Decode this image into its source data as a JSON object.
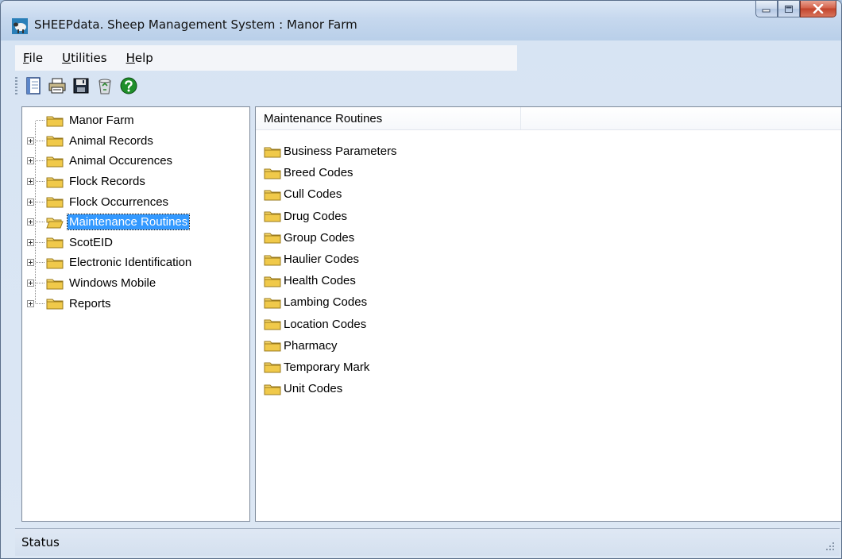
{
  "window": {
    "title": "SHEEPdata. Sheep Management System : Manor Farm",
    "caption_buttons": [
      "minimize",
      "maximize",
      "close"
    ]
  },
  "menu": [
    {
      "label": "File",
      "accel": "F",
      "rest": "ile"
    },
    {
      "label": "Utilities",
      "accel": "U",
      "rest": "tilities"
    },
    {
      "label": "Help",
      "accel": "H",
      "rest": "elp"
    }
  ],
  "toolbar": {
    "icons": [
      "new-document-icon",
      "print-icon",
      "save-icon",
      "recycle-bin-icon",
      "help-icon"
    ]
  },
  "tree": {
    "root": "Manor Farm",
    "items": [
      {
        "label": "Animal Records",
        "expandable": true,
        "selected": false
      },
      {
        "label": "Animal Occurences",
        "expandable": true,
        "selected": false
      },
      {
        "label": "Flock Records",
        "expandable": true,
        "selected": false
      },
      {
        "label": "Flock Occurrences",
        "expandable": true,
        "selected": false
      },
      {
        "label": "Maintenance Routines",
        "expandable": true,
        "selected": true
      },
      {
        "label": "ScotEID",
        "expandable": true,
        "selected": false
      },
      {
        "label": "Electronic Identification",
        "expandable": true,
        "selected": false
      },
      {
        "label": "Windows Mobile",
        "expandable": true,
        "selected": false
      },
      {
        "label": "Reports",
        "expandable": true,
        "selected": false
      }
    ]
  },
  "list": {
    "column_header": "Maintenance Routines",
    "items": [
      "Business Parameters",
      "Breed Codes",
      "Cull Codes",
      "Drug Codes",
      "Group Codes",
      "Haulier Codes",
      "Health Codes",
      "Lambing Codes",
      "Location Codes",
      "Pharmacy",
      "Temporary Mark",
      "Unit Codes"
    ]
  },
  "status": {
    "text": "Status"
  },
  "colors": {
    "selection": "#3399ff",
    "folder_fill": "#f5d66a",
    "folder_stroke": "#9a7a1c"
  }
}
